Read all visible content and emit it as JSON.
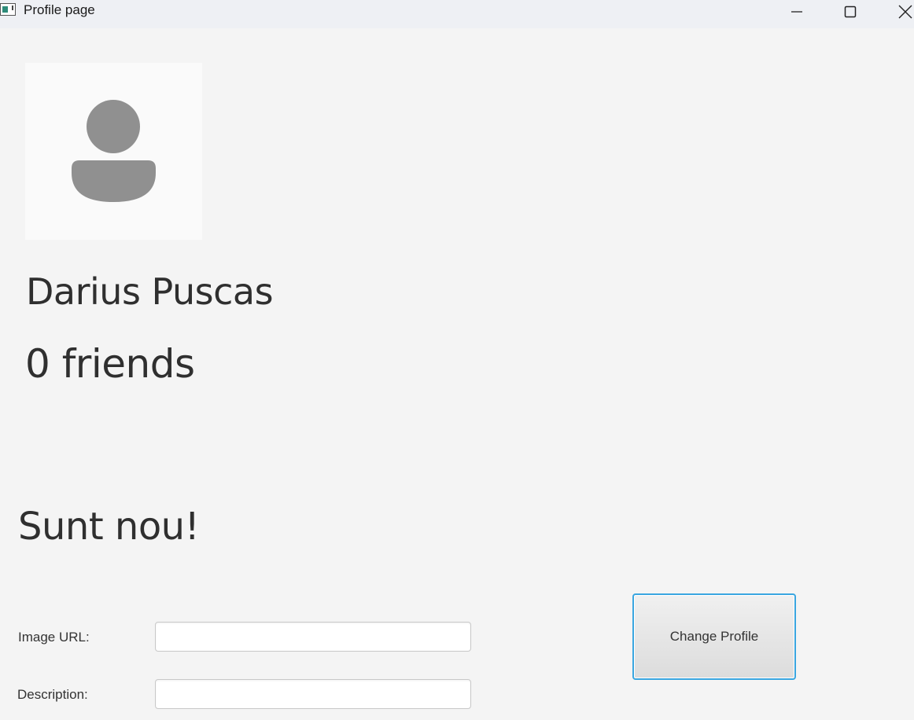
{
  "window": {
    "title": "Profile page",
    "icon": "app-window-icon",
    "controls": {
      "minimize_icon": "minimize-icon",
      "maximize_icon": "maximize-icon",
      "close_icon": "close-icon"
    }
  },
  "profile": {
    "avatar_icon": "user-silhouette-icon",
    "name": "Darius Puscas",
    "friends": "0 friends",
    "description": "Sunt nou!"
  },
  "form": {
    "image_url_label": "Image URL:",
    "image_url_value": "",
    "description_label": "Description:",
    "description_value": "",
    "submit_label": "Change Profile"
  },
  "colors": {
    "background": "#f4f4f4",
    "avatar_bg": "#fafafa",
    "avatar_fg": "#909090",
    "button_focus_border": "#3aa6e0"
  }
}
